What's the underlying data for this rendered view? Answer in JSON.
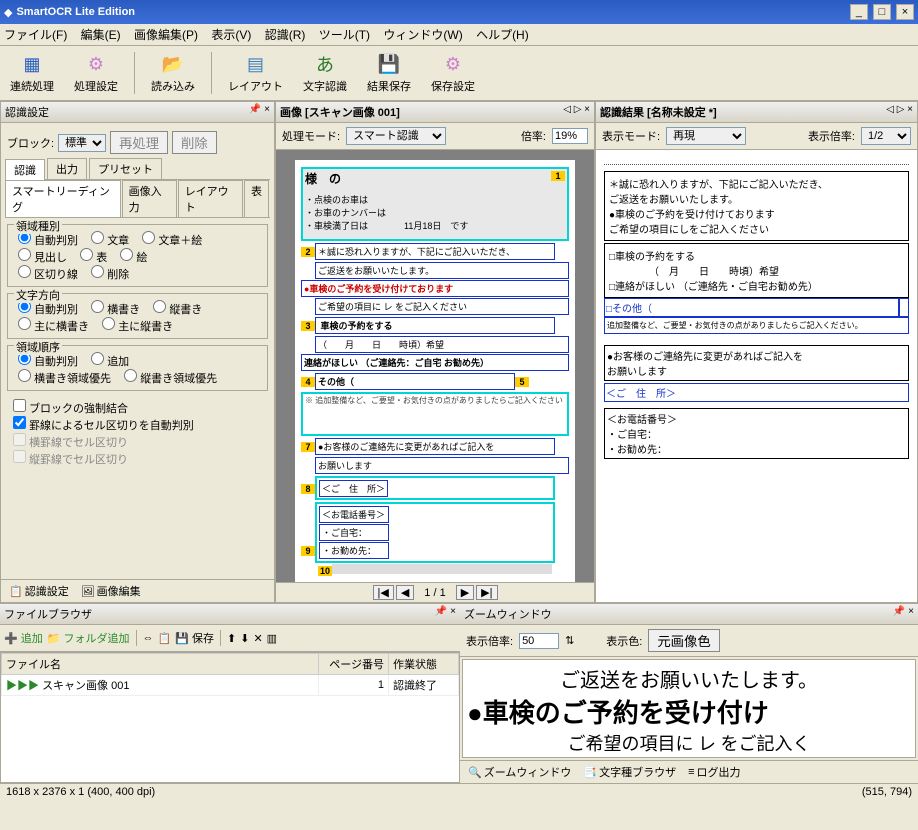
{
  "app": {
    "title": "SmartOCR Lite Edition"
  },
  "menu": {
    "file": "ファイル(F)",
    "edit": "編集(E)",
    "image_edit": "画像編集(P)",
    "view": "表示(V)",
    "recog": "認識(R)",
    "tool": "ツール(T)",
    "window": "ウィンドウ(W)",
    "help": "ヘルプ(H)"
  },
  "toolbar": {
    "cont": "連続処理",
    "procset": "処理設定",
    "load": "読み込み",
    "layout": "レイアウト",
    "ocr": "文字認識",
    "save": "結果保存",
    "saveset": "保存設定"
  },
  "left_pane": {
    "title": "認識設定",
    "block_label": "ブロック:",
    "block_value": "標準",
    "reproc": "再処理",
    "delete": "削除",
    "tabs": {
      "recog": "認識",
      "output": "出力",
      "preset": "プリセット"
    },
    "subtabs": {
      "smart": "スマートリーディング",
      "imgin": "画像入力",
      "layout": "レイアウト",
      "table": "表"
    },
    "region_type": {
      "title": "領域種別",
      "auto": "自動判別",
      "text": "文章",
      "text_fig": "文章＋絵",
      "heading": "見出し",
      "table": "表",
      "fig": "絵",
      "sep": "区切り線",
      "delete": "削除"
    },
    "direction": {
      "title": "文字方向",
      "auto": "自動判別",
      "horiz": "横書き",
      "vert": "縦書き",
      "mainly_h": "主に横書き",
      "mainly_v": "主に縦書き"
    },
    "order": {
      "title": "領域順序",
      "auto": "自動判別",
      "append": "追加",
      "h_first": "横書き領域優先",
      "v_first": "縦書き領域優先"
    },
    "checks": {
      "force_merge": "ブロックの強制結合",
      "ruled_cell_auto": "罫線によるセル区切りを自動判別",
      "h_ruled": "横罫線でセル区切り",
      "v_ruled": "縦罫線でセル区切り"
    },
    "bottom_tabs": {
      "recog": "認識設定",
      "image": "画像編集"
    }
  },
  "center_pane": {
    "title": "画像 [スキャン画像 001]",
    "mode_label": "処理モード:",
    "mode_value": "スマート認識",
    "zoom_label": "倍率:",
    "zoom_value": "19%",
    "doc": {
      "header_name": "様　の",
      "line1": "・点検のお車は",
      "line2": "・お車のナンバーは",
      "line3": "・車検満了日は　　　　11月18日　です",
      "b2a": "＊誠に恐れ入りますが、下記にご記入いただき、",
      "b2b": "ご返送をお願いいたします。",
      "b3": "●車検のご予約を受け付けております",
      "b3b": "ご希望の項目に レ をご記入ください",
      "b4": "車検の予約をする",
      "b4b": "（　　月　　日　　時頃）希望",
      "b5": "連絡がほしい （ご連絡先：ご自宅 お勧め先）",
      "b6": "その他（",
      "b6b": "※ 追加整備など、ご要望・お気付きの点がありましたらご記入ください",
      "b7": "●お客様のご連絡先に変更があればご記入を",
      "b7b": "お願いします",
      "b8": "＜ご　住　所＞",
      "b9t": "＜お電話番号＞",
      "b9a": "・ご自宅：",
      "b9b": "・お勤め先："
    },
    "pager": {
      "current": "1 / 1"
    }
  },
  "right_pane": {
    "title": "認識結果 [名称未設定 *]",
    "mode_label": "表示モード:",
    "mode_value": "再現",
    "zoom_label": "表示倍率:",
    "zoom_value": "1/2",
    "res": {
      "l1": "＊誠に恐れ入りますが、下記にご記入いただき、",
      "l2": "ご返送をお願いいたします。",
      "l3": "●車検のご予約を受け付けております",
      "l4": "ご希望の項目にしをご記入ください",
      "l5": "□車検の予約をする",
      "l6": "（　月　　日　　時頃）希望",
      "l7": "□連絡がほしい （ご連絡先・ご自宅お勧め先）",
      "l8": "□その他（",
      "l8b": "追加整備など、ご要望・お気付きの点がありましたらご記入ください。",
      "l9": "●お客様のご連絡先に変更があればご記入を",
      "l10": "お願いします",
      "l11": "＜ご　住　所＞",
      "l12": "＜お電話番号＞",
      "l13": "・ご自宅：",
      "l14": "・お勧め先："
    }
  },
  "filebrowser": {
    "title": "ファイルブラウザ",
    "add": "追加",
    "folder_add": "フォルダ追加",
    "save": "保存",
    "col_file": "ファイル名",
    "col_page": "ページ番号",
    "col_status": "作業状態",
    "row1_file": "スキャン画像 001",
    "row1_page": "1",
    "row1_status": "認識終了"
  },
  "zoomwin": {
    "title": "ズームウィンドウ",
    "zoom_label": "表示倍率:",
    "zoom_value": "50",
    "color_label": "表示色:",
    "color_value": "元画像色",
    "line1": "ご返送をお願いいたします。",
    "line2": "●車検のご予約を受け付け",
    "line3": "ご希望の項目に レ をご記入く",
    "tabs": {
      "zoom": "ズームウィンドウ",
      "chartype": "文字種ブラウザ",
      "log": "ログ出力"
    }
  },
  "status": {
    "left": "1618 x 2376 x 1 (400, 400 dpi)",
    "right": "(515, 794)"
  }
}
